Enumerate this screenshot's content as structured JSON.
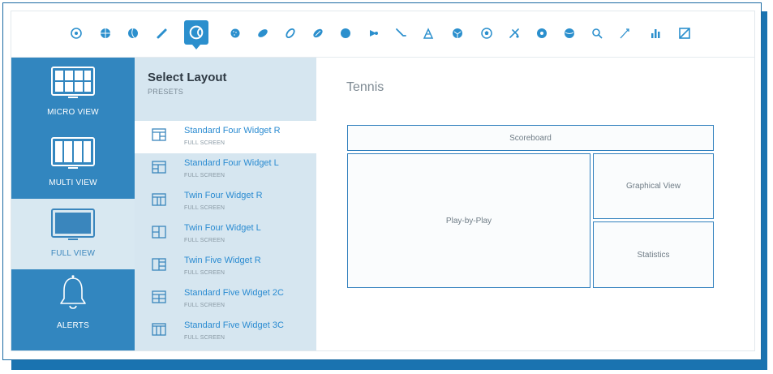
{
  "sports": [
    {
      "icon": "soccer-ball-icon"
    },
    {
      "icon": "basketball-icon"
    },
    {
      "icon": "volleyball-icon"
    },
    {
      "icon": "baseball-bat-icon"
    },
    {
      "icon": "tennis-ball-icon",
      "active": true
    },
    {
      "icon": "golf-ball-icon"
    },
    {
      "icon": "american-football-icon"
    },
    {
      "icon": "rugby-ball-icon"
    },
    {
      "icon": "rugby-icon"
    },
    {
      "icon": "bowling-ball-icon"
    },
    {
      "icon": "badminton-icon"
    },
    {
      "icon": "hockey-stick-icon"
    },
    {
      "icon": "racing-flag-icon"
    },
    {
      "icon": "handball-icon"
    },
    {
      "icon": "futsal-icon"
    },
    {
      "icon": "ice-hockey-icon"
    },
    {
      "icon": "snooker-icon"
    },
    {
      "icon": "water-polo-icon"
    },
    {
      "icon": "table-tennis-icon"
    },
    {
      "icon": "darts-icon"
    },
    {
      "icon": "statistics-icon"
    },
    {
      "icon": "other-sport-icon"
    }
  ],
  "views": {
    "micro": {
      "label": "MICRO VIEW"
    },
    "multi": {
      "label": "MULTI VIEW"
    },
    "full": {
      "label": "FULL VIEW"
    },
    "alerts": {
      "label": "ALERTS"
    }
  },
  "presets": {
    "title": "Select Layout",
    "subtitle": "PRESETS",
    "items": [
      {
        "name": "Standard Four Widget R",
        "tag": "FULL SCREEN",
        "selected": true
      },
      {
        "name": "Standard Four Widget L",
        "tag": "FULL SCREEN"
      },
      {
        "name": "Twin Four Widget R",
        "tag": "FULL SCREEN"
      },
      {
        "name": "Twin Four Widget L",
        "tag": "FULL SCREEN"
      },
      {
        "name": "Twin Five Widget R",
        "tag": "FULL SCREEN"
      },
      {
        "name": "Standard Five Widget 2C",
        "tag": "FULL SCREEN"
      },
      {
        "name": "Standard Five Widget 3C",
        "tag": "FULL SCREEN"
      }
    ]
  },
  "layout": {
    "sport": "Tennis",
    "widgets": {
      "scoreboard": "Scoreboard",
      "play_by_play": "Play-by-Play",
      "graphical_view": "Graphical View",
      "statistics": "Statistics"
    }
  },
  "colors": {
    "accent": "#2b8fcd",
    "sidebar_dark": "#3286bf",
    "sidebar_light": "#d8e8f1",
    "presets_bg": "#d6e6f0",
    "link": "#2a8bd1",
    "widget_border": "#2f7fbd"
  }
}
